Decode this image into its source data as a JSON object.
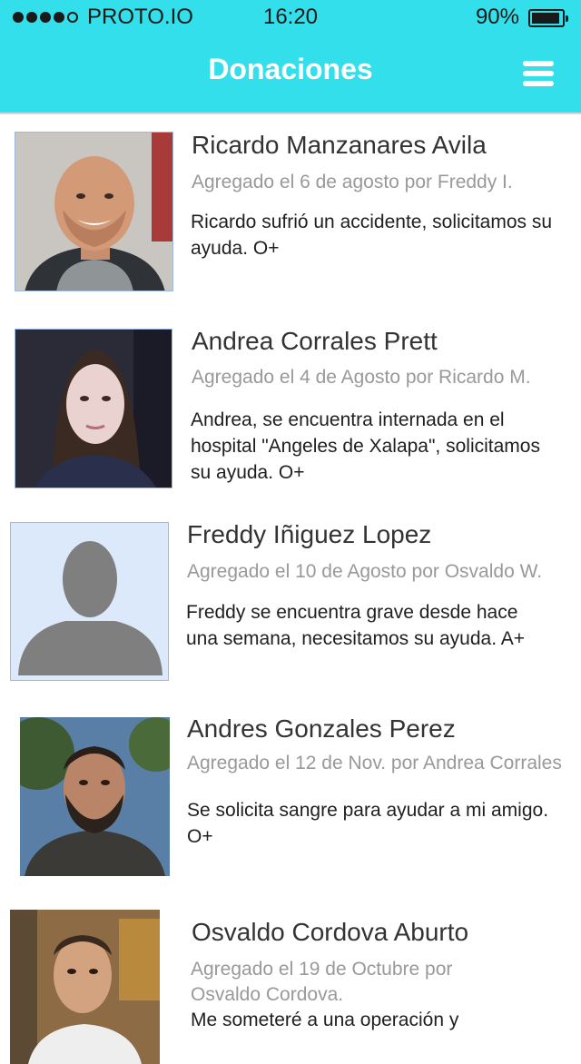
{
  "status_bar": {
    "carrier": "PROTO.IO",
    "time": "16:20",
    "battery": "90%"
  },
  "header": {
    "title": "Donaciones",
    "menu_icon": "hamburger-menu-icon"
  },
  "donations": [
    {
      "name": "Ricardo Manzanares Avila",
      "meta": "Agregado el 6 de agosto por Freddy I.",
      "description": "Ricardo sufrió un accidente, solicitamos su ayuda. O+"
    },
    {
      "name": "Andrea Corrales Prett",
      "meta": "Agregado el 4 de Agosto por Ricardo M.",
      "description": "Andrea, se encuentra internada en el hospital \"Angeles de Xalapa\", solicitamos su ayuda. O+"
    },
    {
      "name": "Freddy Iñiguez Lopez",
      "meta": "Agregado el 10 de Agosto por Osvaldo W.",
      "description": "Freddy se encuentra grave desde hace una semana, necesitamos su ayuda. A+"
    },
    {
      "name": "Andres Gonzales Perez",
      "meta": "Agregado el 12 de Nov. por Andrea Corrales",
      "description": "Se solicita sangre para ayudar a mi amigo. O+"
    },
    {
      "name": "Osvaldo Cordova Aburto",
      "meta": "Agregado el 19 de Octubre por Osvaldo Cordova.",
      "description": "Me someteré a una operación y"
    }
  ]
}
